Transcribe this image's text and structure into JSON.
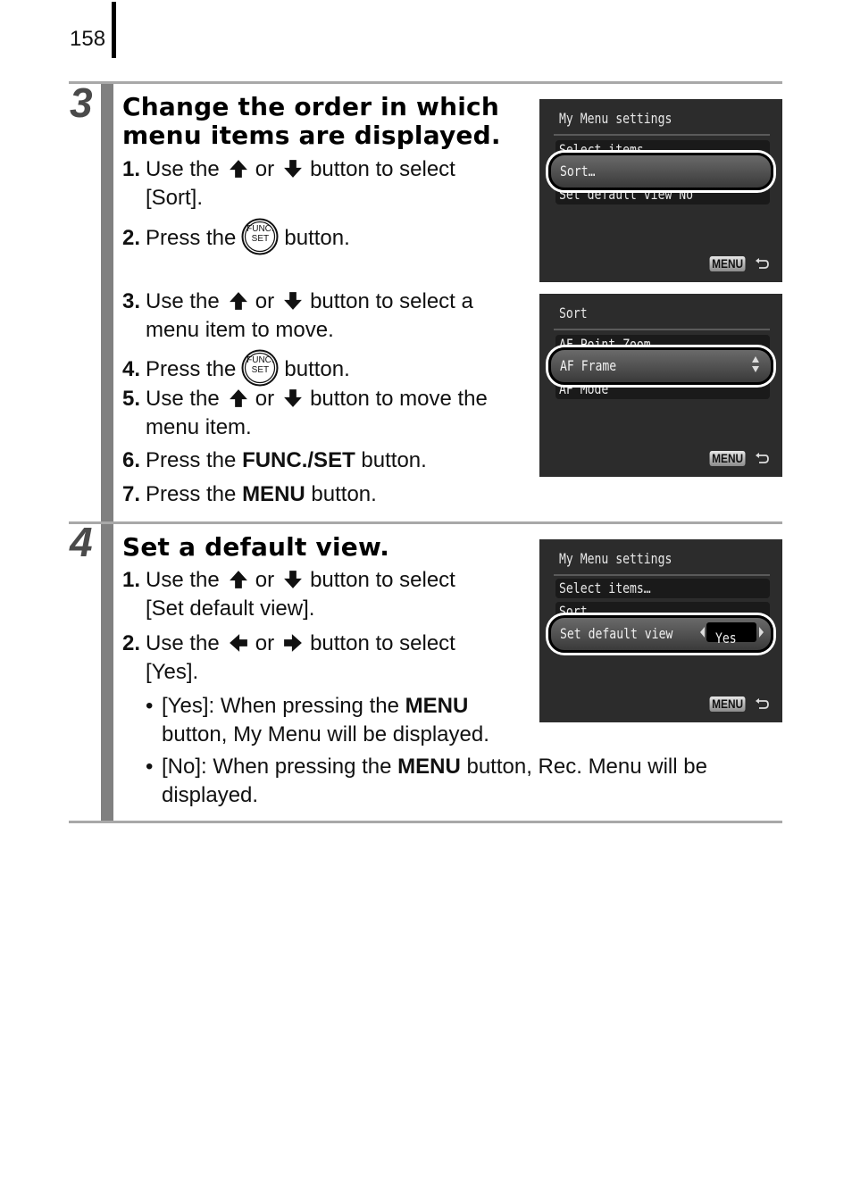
{
  "page_number": "158",
  "steps": [
    {
      "number": "3",
      "heading_line1": "Change the order in which",
      "heading_line2": "menu items are displayed.",
      "items": [
        {
          "n": "1.",
          "pre": "Use the",
          "mid": "or",
          "post": "button to select",
          "cont": "[Sort]."
        },
        {
          "n": "2.",
          "pre": "Press the",
          "post": "button."
        },
        {
          "n": "3.",
          "pre": "Use the",
          "mid": "or",
          "post": "button to select a",
          "cont": "menu item to move."
        },
        {
          "n": "4.",
          "pre": "Press the",
          "post": "button."
        },
        {
          "n": "5.",
          "pre": "Use the",
          "mid": "or",
          "post": "button to move the",
          "cont": "menu item."
        },
        {
          "n": "6.",
          "pre": "Press the",
          "bold": "FUNC./SET",
          "post": "button."
        },
        {
          "n": "7.",
          "pre": "Press the",
          "bold": "MENU",
          "post": "button."
        }
      ]
    },
    {
      "number": "4",
      "heading": "Set a default view.",
      "items": [
        {
          "n": "1.",
          "pre": "Use the",
          "mid": "or",
          "post": "button to select",
          "cont": "[Set default view]."
        },
        {
          "n": "2.",
          "pre": "Use the",
          "mid": "or",
          "post": "button to select",
          "cont": "[Yes]."
        }
      ],
      "bullets": [
        {
          "dot": "•",
          "pre": "[Yes]: When pressing the",
          "bold": "MENU",
          "cont": "button, My Menu will be displayed."
        },
        {
          "dot": "•",
          "pre": "[No]: When pressing the",
          "bold": "MENU",
          "post": "button, Rec. Menu will be",
          "cont": "displayed."
        }
      ]
    }
  ],
  "screens": [
    {
      "title": "My Menu settings",
      "rows": [
        "Select items…",
        "Set default view      No"
      ],
      "selected": "Sort…",
      "menu_label": "MENU"
    },
    {
      "title": "Sort",
      "rows": [
        "AF Point Zoom",
        "AF Mode"
      ],
      "selected": "AF Frame",
      "menu_label": "MENU"
    },
    {
      "title": "My Menu settings",
      "rows": [
        "Select items…",
        "Sort…"
      ],
      "selected": "Set default view",
      "selected_value": "Yes",
      "menu_label": "MENU"
    }
  ],
  "icons": {
    "func_set_top": "FUNC.",
    "func_set_bottom": "SET"
  }
}
